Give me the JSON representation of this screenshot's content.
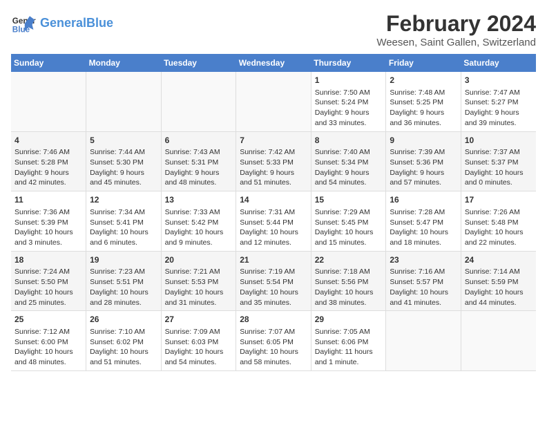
{
  "header": {
    "logo_line1": "General",
    "logo_line2": "Blue",
    "month_title": "February 2024",
    "location": "Weesen, Saint Gallen, Switzerland"
  },
  "days_of_week": [
    "Sunday",
    "Monday",
    "Tuesday",
    "Wednesday",
    "Thursday",
    "Friday",
    "Saturday"
  ],
  "weeks": [
    [
      {
        "day": "",
        "content": ""
      },
      {
        "day": "",
        "content": ""
      },
      {
        "day": "",
        "content": ""
      },
      {
        "day": "",
        "content": ""
      },
      {
        "day": "1",
        "content": "Sunrise: 7:50 AM\nSunset: 5:24 PM\nDaylight: 9 hours\nand 33 minutes."
      },
      {
        "day": "2",
        "content": "Sunrise: 7:48 AM\nSunset: 5:25 PM\nDaylight: 9 hours\nand 36 minutes."
      },
      {
        "day": "3",
        "content": "Sunrise: 7:47 AM\nSunset: 5:27 PM\nDaylight: 9 hours\nand 39 minutes."
      }
    ],
    [
      {
        "day": "4",
        "content": "Sunrise: 7:46 AM\nSunset: 5:28 PM\nDaylight: 9 hours\nand 42 minutes."
      },
      {
        "day": "5",
        "content": "Sunrise: 7:44 AM\nSunset: 5:30 PM\nDaylight: 9 hours\nand 45 minutes."
      },
      {
        "day": "6",
        "content": "Sunrise: 7:43 AM\nSunset: 5:31 PM\nDaylight: 9 hours\nand 48 minutes."
      },
      {
        "day": "7",
        "content": "Sunrise: 7:42 AM\nSunset: 5:33 PM\nDaylight: 9 hours\nand 51 minutes."
      },
      {
        "day": "8",
        "content": "Sunrise: 7:40 AM\nSunset: 5:34 PM\nDaylight: 9 hours\nand 54 minutes."
      },
      {
        "day": "9",
        "content": "Sunrise: 7:39 AM\nSunset: 5:36 PM\nDaylight: 9 hours\nand 57 minutes."
      },
      {
        "day": "10",
        "content": "Sunrise: 7:37 AM\nSunset: 5:37 PM\nDaylight: 10 hours\nand 0 minutes."
      }
    ],
    [
      {
        "day": "11",
        "content": "Sunrise: 7:36 AM\nSunset: 5:39 PM\nDaylight: 10 hours\nand 3 minutes."
      },
      {
        "day": "12",
        "content": "Sunrise: 7:34 AM\nSunset: 5:41 PM\nDaylight: 10 hours\nand 6 minutes."
      },
      {
        "day": "13",
        "content": "Sunrise: 7:33 AM\nSunset: 5:42 PM\nDaylight: 10 hours\nand 9 minutes."
      },
      {
        "day": "14",
        "content": "Sunrise: 7:31 AM\nSunset: 5:44 PM\nDaylight: 10 hours\nand 12 minutes."
      },
      {
        "day": "15",
        "content": "Sunrise: 7:29 AM\nSunset: 5:45 PM\nDaylight: 10 hours\nand 15 minutes."
      },
      {
        "day": "16",
        "content": "Sunrise: 7:28 AM\nSunset: 5:47 PM\nDaylight: 10 hours\nand 18 minutes."
      },
      {
        "day": "17",
        "content": "Sunrise: 7:26 AM\nSunset: 5:48 PM\nDaylight: 10 hours\nand 22 minutes."
      }
    ],
    [
      {
        "day": "18",
        "content": "Sunrise: 7:24 AM\nSunset: 5:50 PM\nDaylight: 10 hours\nand 25 minutes."
      },
      {
        "day": "19",
        "content": "Sunrise: 7:23 AM\nSunset: 5:51 PM\nDaylight: 10 hours\nand 28 minutes."
      },
      {
        "day": "20",
        "content": "Sunrise: 7:21 AM\nSunset: 5:53 PM\nDaylight: 10 hours\nand 31 minutes."
      },
      {
        "day": "21",
        "content": "Sunrise: 7:19 AM\nSunset: 5:54 PM\nDaylight: 10 hours\nand 35 minutes."
      },
      {
        "day": "22",
        "content": "Sunrise: 7:18 AM\nSunset: 5:56 PM\nDaylight: 10 hours\nand 38 minutes."
      },
      {
        "day": "23",
        "content": "Sunrise: 7:16 AM\nSunset: 5:57 PM\nDaylight: 10 hours\nand 41 minutes."
      },
      {
        "day": "24",
        "content": "Sunrise: 7:14 AM\nSunset: 5:59 PM\nDaylight: 10 hours\nand 44 minutes."
      }
    ],
    [
      {
        "day": "25",
        "content": "Sunrise: 7:12 AM\nSunset: 6:00 PM\nDaylight: 10 hours\nand 48 minutes."
      },
      {
        "day": "26",
        "content": "Sunrise: 7:10 AM\nSunset: 6:02 PM\nDaylight: 10 hours\nand 51 minutes."
      },
      {
        "day": "27",
        "content": "Sunrise: 7:09 AM\nSunset: 6:03 PM\nDaylight: 10 hours\nand 54 minutes."
      },
      {
        "day": "28",
        "content": "Sunrise: 7:07 AM\nSunset: 6:05 PM\nDaylight: 10 hours\nand 58 minutes."
      },
      {
        "day": "29",
        "content": "Sunrise: 7:05 AM\nSunset: 6:06 PM\nDaylight: 11 hours\nand 1 minute."
      },
      {
        "day": "",
        "content": ""
      },
      {
        "day": "",
        "content": ""
      }
    ]
  ]
}
